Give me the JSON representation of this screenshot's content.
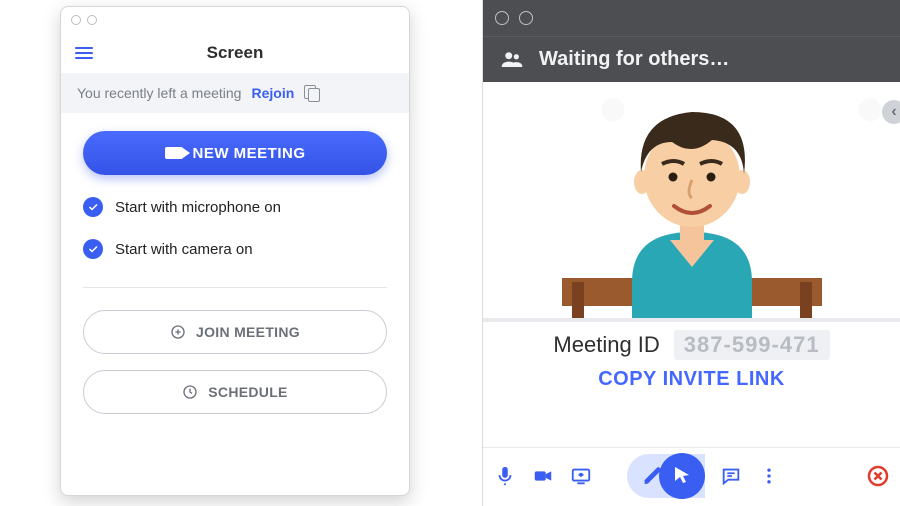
{
  "left": {
    "title": "Screen",
    "banner": {
      "text": "You recently left a meeting",
      "rejoin": "Rejoin"
    },
    "newMeeting": "NEW MEETING",
    "options": {
      "mic": "Start with microphone on",
      "cam": "Start with camera on"
    },
    "joinMeeting": "JOIN MEETING",
    "schedule": "SCHEDULE"
  },
  "right": {
    "status": "Waiting for others…",
    "meetingIdLabel": "Meeting ID",
    "meetingIdValue": "387-599-471",
    "copyLink": "COPY INVITE LINK"
  },
  "icons": {
    "hamburger": "hamburger-icon",
    "copy": "copy-icon",
    "people": "people-icon",
    "mic": "mic-icon",
    "camera": "camera-icon",
    "share": "share-screen-icon",
    "pen": "pencil-icon",
    "pointer": "pointer-icon",
    "chat": "chat-icon",
    "more": "more-icon",
    "close": "close-icon"
  },
  "colors": {
    "primary": "#3a5ef2",
    "danger": "#e23c2c"
  }
}
